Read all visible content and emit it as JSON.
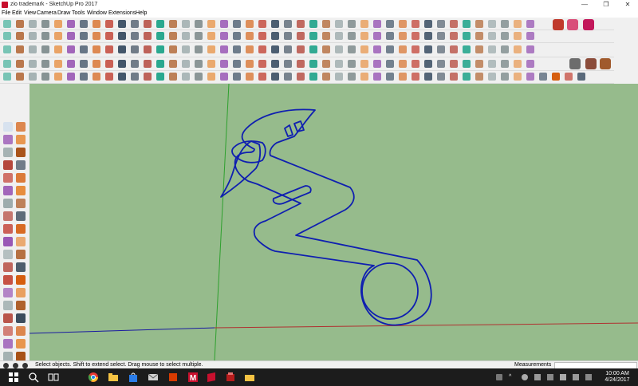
{
  "window": {
    "title": "zio trademark - SketchUp Pro 2017",
    "minimize_glyph": "—",
    "maximize_glyph": "❐",
    "close_glyph": "✕"
  },
  "menu": [
    "File",
    "Edit",
    "View",
    "Camera",
    "Draw",
    "Tools",
    "Window",
    "Extensions",
    "Help"
  ],
  "status": {
    "hint": "Select objects. Shift to extend select. Drag mouse to select multiple.",
    "measurements_label": "Measurements",
    "measurements_value": ""
  },
  "taskbar": {
    "time": "10:00 AM",
    "date": "4/24/2017",
    "apps": [
      "windows-start",
      "search",
      "task-view",
      "chrome",
      "file-explorer",
      "store",
      "mail",
      "office",
      "mcafee",
      "sketchup",
      "extension-warehouse",
      "folder"
    ]
  },
  "colors": {
    "viewport_bg": "#96bb8c",
    "drawing_stroke": "#0f1fb0",
    "axis_red": "#b03030",
    "axis_green": "#2ea02e",
    "axis_blue": "#1a1aa0"
  }
}
